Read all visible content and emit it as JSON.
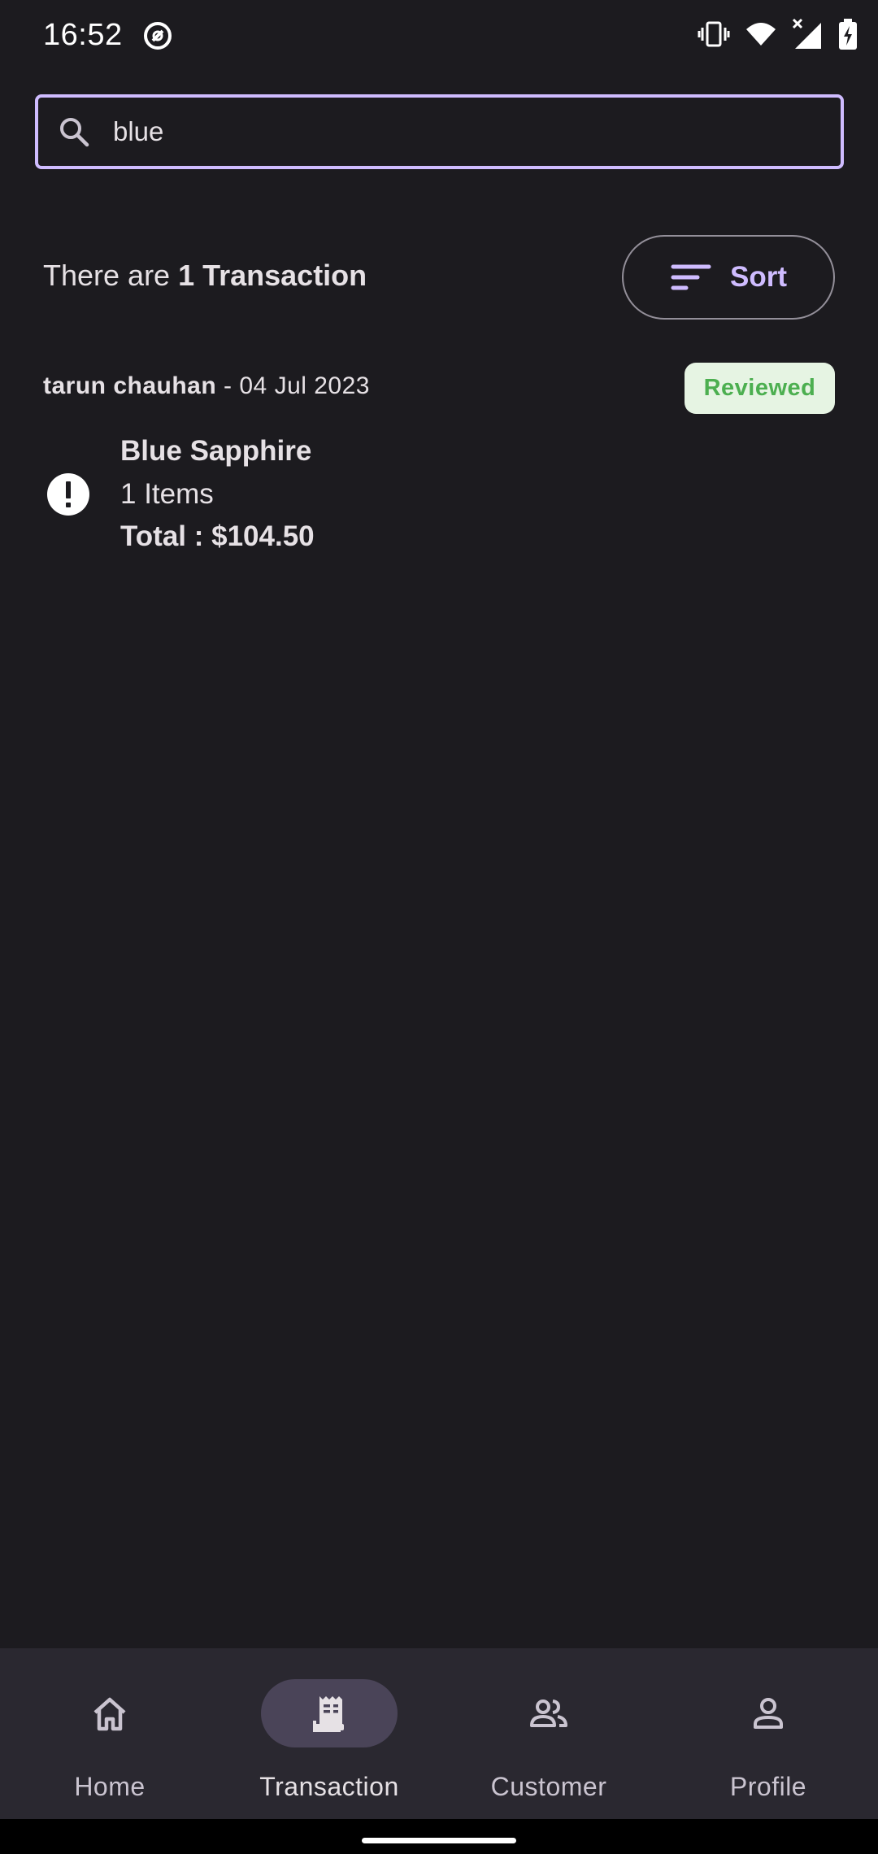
{
  "status_bar": {
    "time": "16:52",
    "icons": [
      "app-notification-icon",
      "vibrate-icon",
      "wifi-icon",
      "signal-icon",
      "battery-charging-icon"
    ]
  },
  "search": {
    "value": "blue",
    "placeholder": "",
    "icon": "search-icon",
    "border_color": "#cfbcff"
  },
  "summary": {
    "prefix": "There are ",
    "count_text": "1 Transaction"
  },
  "sort_button": {
    "label": "Sort",
    "icon": "sort-icon"
  },
  "transactions": [
    {
      "customer": "tarun chauhan",
      "date_text": " - 04 Jul 2023",
      "status": "Reviewed",
      "status_color": "#4caf50",
      "status_bg": "#e6f4e3",
      "icon": "alert-circle-icon",
      "product": "Blue Sapphire",
      "items": "1 Items",
      "total": "Total : $104.50"
    }
  ],
  "bottom_nav": {
    "items": [
      {
        "label": "Home",
        "icon": "home-icon",
        "active": false
      },
      {
        "label": "Transaction",
        "icon": "receipt-icon",
        "active": true
      },
      {
        "label": "Customer",
        "icon": "people-icon",
        "active": false
      },
      {
        "label": "Profile",
        "icon": "person-icon",
        "active": false
      }
    ]
  },
  "colors": {
    "background": "#1c1b1f",
    "accent": "#cfbcff",
    "nav_background": "#2a2830",
    "nav_active_pill": "#4a4458"
  }
}
